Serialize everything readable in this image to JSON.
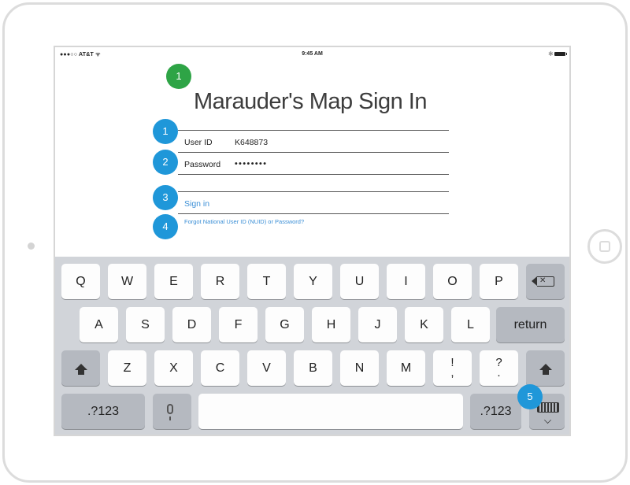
{
  "status_bar": {
    "carrier": "●●●○○ AT&T ᯤ",
    "time": "9:45 AM",
    "bluetooth": "✱"
  },
  "form": {
    "title": "Marauder's Map Sign In",
    "userid_label": "User ID",
    "userid_value": "K648873",
    "password_label": "Password",
    "password_value": "••••••••",
    "signin_label": "Sign in",
    "forgot_label": "Forgot National User ID (NUID) or Password?"
  },
  "badges": {
    "title_badge": "1",
    "userid_badge": "1",
    "password_badge": "2",
    "signin_badge": "3",
    "forgot_badge": "4",
    "keyboard_badge": "5"
  },
  "keyboard": {
    "row1": [
      "Q",
      "W",
      "E",
      "R",
      "T",
      "Y",
      "U",
      "I",
      "O",
      "P"
    ],
    "row2": [
      "A",
      "S",
      "D",
      "F",
      "G",
      "H",
      "J",
      "K",
      "L"
    ],
    "return_label": "return",
    "row3": [
      "Z",
      "X",
      "C",
      "V",
      "B",
      "N",
      "M"
    ],
    "punct1_top": "!",
    "punct1_bottom": ",",
    "punct2_top": "?",
    "punct2_bottom": ".",
    "numbers_label": ".?123",
    "numbers_label_right": ".?123"
  },
  "colors": {
    "accent_link": "#3b8fd6",
    "badge_green": "#2ea446",
    "badge_blue": "#1f97d9",
    "keyboard_bg": "#d1d4d9"
  }
}
